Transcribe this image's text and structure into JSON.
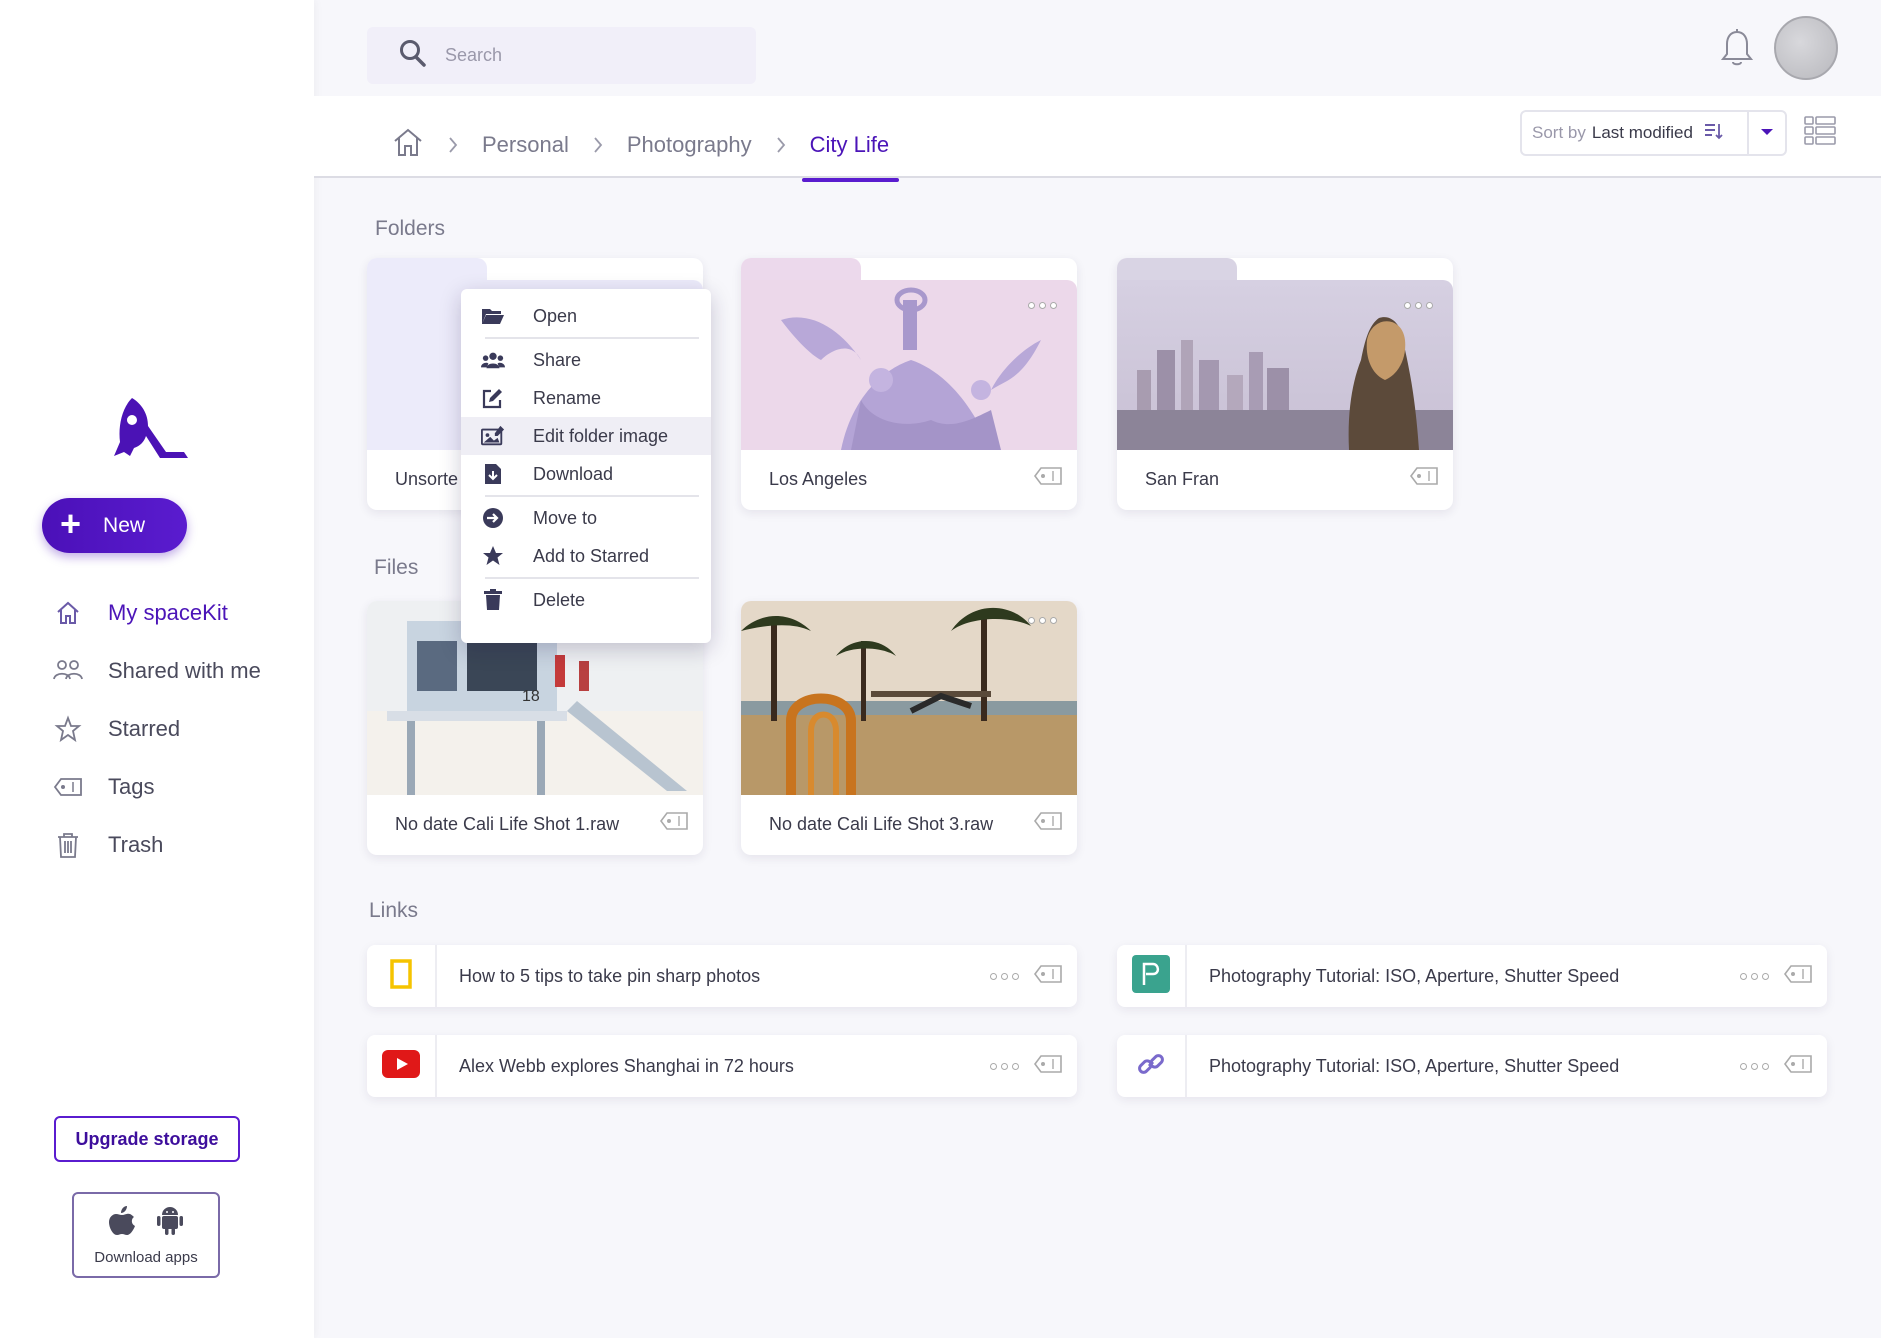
{
  "sidebar": {
    "new_label": "New",
    "items": [
      {
        "label": "My spaceKit",
        "icon": "home-icon",
        "active": true
      },
      {
        "label": "Shared with me",
        "icon": "users-icon"
      },
      {
        "label": "Starred",
        "icon": "star-icon"
      },
      {
        "label": "Tags",
        "icon": "tag-icon"
      },
      {
        "label": "Trash",
        "icon": "trash-icon"
      }
    ],
    "upgrade_label": "Upgrade storage",
    "download_apps_label": "Download apps"
  },
  "header": {
    "search_placeholder": "Search",
    "breadcrumb": [
      "Personal",
      "Photography",
      "City Life"
    ],
    "sort_prefix": "Sort by",
    "sort_value": "Last modified"
  },
  "sections": {
    "folders": "Folders",
    "files": "Files",
    "links": "Links"
  },
  "folders": [
    {
      "name": "Unsorte"
    },
    {
      "name": "Los Angeles"
    },
    {
      "name": "San Fran"
    }
  ],
  "files": [
    {
      "name": "No date Cali Life Shot 1.raw"
    },
    {
      "name": "No date Cali Life Shot 3.raw"
    }
  ],
  "links": [
    {
      "title": "How to 5 tips to take pin sharp photos",
      "icon": "natgeo-icon"
    },
    {
      "title": "Photography Tutorial: ISO, Aperture, Shutter Speed",
      "icon": "p-brand-icon"
    },
    {
      "title": "Alex Webb explores Shanghai in 72 hours",
      "icon": "youtube-icon"
    },
    {
      "title": "Photography Tutorial: ISO, Aperture, Shutter Speed",
      "icon": "link-icon"
    }
  ],
  "context_menu": {
    "items": [
      "Open",
      "Share",
      "Rename",
      "Edit folder image",
      "Download",
      "Move to",
      "Add to Starred",
      "Delete"
    ],
    "highlighted": "Edit folder image"
  },
  "colors": {
    "accent": "#5a1ccf",
    "accent_dark": "#4b10b8",
    "background": "#f7f7fb"
  }
}
